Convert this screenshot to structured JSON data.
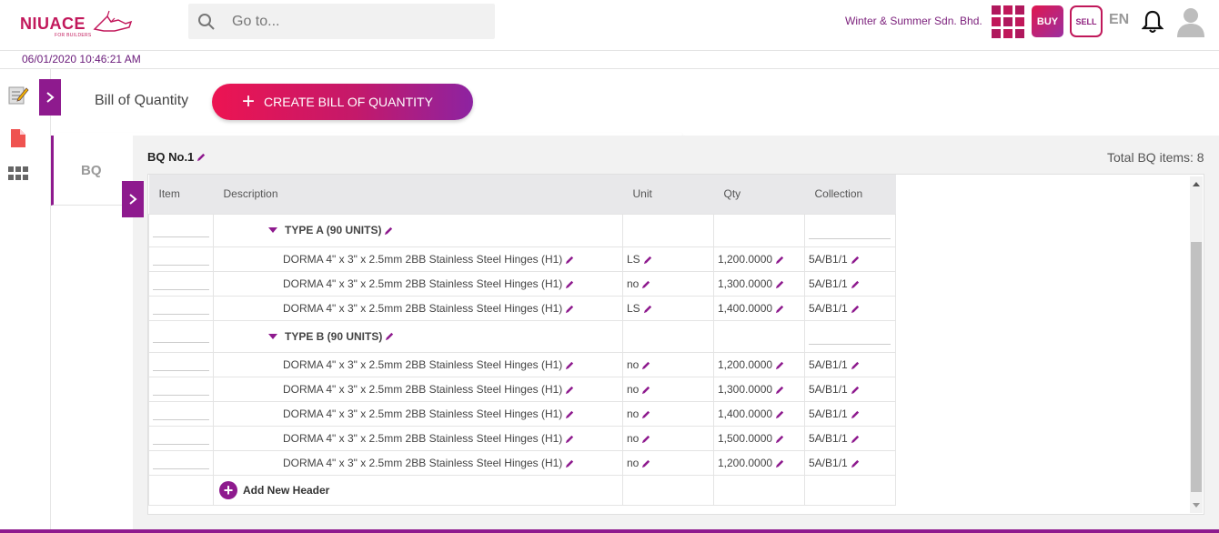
{
  "brand": {
    "name": "NIUACE",
    "tagline": "FOR BUILDERS"
  },
  "search": {
    "placeholder": "Go to..."
  },
  "header": {
    "company": "Winter & Summer Sdn. Bhd.",
    "buy_label": "BUY",
    "sell_label": "SELL",
    "language": "EN"
  },
  "datetime": "06/01/2020 10:46:21 AM",
  "page": {
    "title": "Bill of Quantity",
    "create_button": "CREATE BILL OF QUANTITY",
    "side_tab": "BQ"
  },
  "bq": {
    "title": "BQ No.1",
    "total": "Total BQ items: 8",
    "columns": [
      "Item",
      "Description",
      "Unit",
      "Qty",
      "Collection"
    ],
    "groups": [
      {
        "header": "TYPE A (90 UNITS)",
        "rows": [
          {
            "description": "DORMA 4\" x 3\" x 2.5mm 2BB Stainless Steel Hinges (H1)",
            "unit": "LS",
            "qty": "1,200.0000",
            "collection": "5A/B1/1"
          },
          {
            "description": "DORMA 4\" x 3\" x 2.5mm 2BB Stainless Steel Hinges (H1)",
            "unit": "no",
            "qty": "1,300.0000",
            "collection": "5A/B1/1"
          },
          {
            "description": "DORMA 4\" x 3\" x 2.5mm 2BB Stainless Steel Hinges (H1)",
            "unit": "LS",
            "qty": "1,400.0000",
            "collection": "5A/B1/1"
          }
        ]
      },
      {
        "header": "TYPE B (90 UNITS)",
        "rows": [
          {
            "description": "DORMA 4\" x 3\" x 2.5mm 2BB Stainless Steel Hinges (H1)",
            "unit": "no",
            "qty": "1,200.0000",
            "collection": "5A/B1/1"
          },
          {
            "description": "DORMA 4\" x 3\" x 2.5mm 2BB Stainless Steel Hinges (H1)",
            "unit": "no",
            "qty": "1,300.0000",
            "collection": "5A/B1/1"
          },
          {
            "description": "DORMA 4\" x 3\" x 2.5mm 2BB Stainless Steel Hinges (H1)",
            "unit": "no",
            "qty": "1,400.0000",
            "collection": "5A/B1/1"
          },
          {
            "description": "DORMA 4\" x 3\" x 2.5mm 2BB Stainless Steel Hinges (H1)",
            "unit": "no",
            "qty": "1,500.0000",
            "collection": "5A/B1/1"
          },
          {
            "description": "DORMA 4\" x 3\" x 2.5mm 2BB Stainless Steel Hinges (H1)",
            "unit": "no",
            "qty": "1,200.0000",
            "collection": "5A/B1/1"
          }
        ]
      }
    ],
    "add_header_label": "Add New Header"
  },
  "colors": {
    "accent": "#8e1a8e",
    "brand": "#c2185b"
  },
  "icons": {
    "search": "search-icon",
    "apps": "apps-grid-icon",
    "bell": "bell-icon",
    "avatar": "avatar-icon",
    "rail": [
      "edit-note-icon",
      "document-icon",
      "grid-icon"
    ],
    "edit": "pencil-icon",
    "expand": "chevron-right-icon"
  }
}
